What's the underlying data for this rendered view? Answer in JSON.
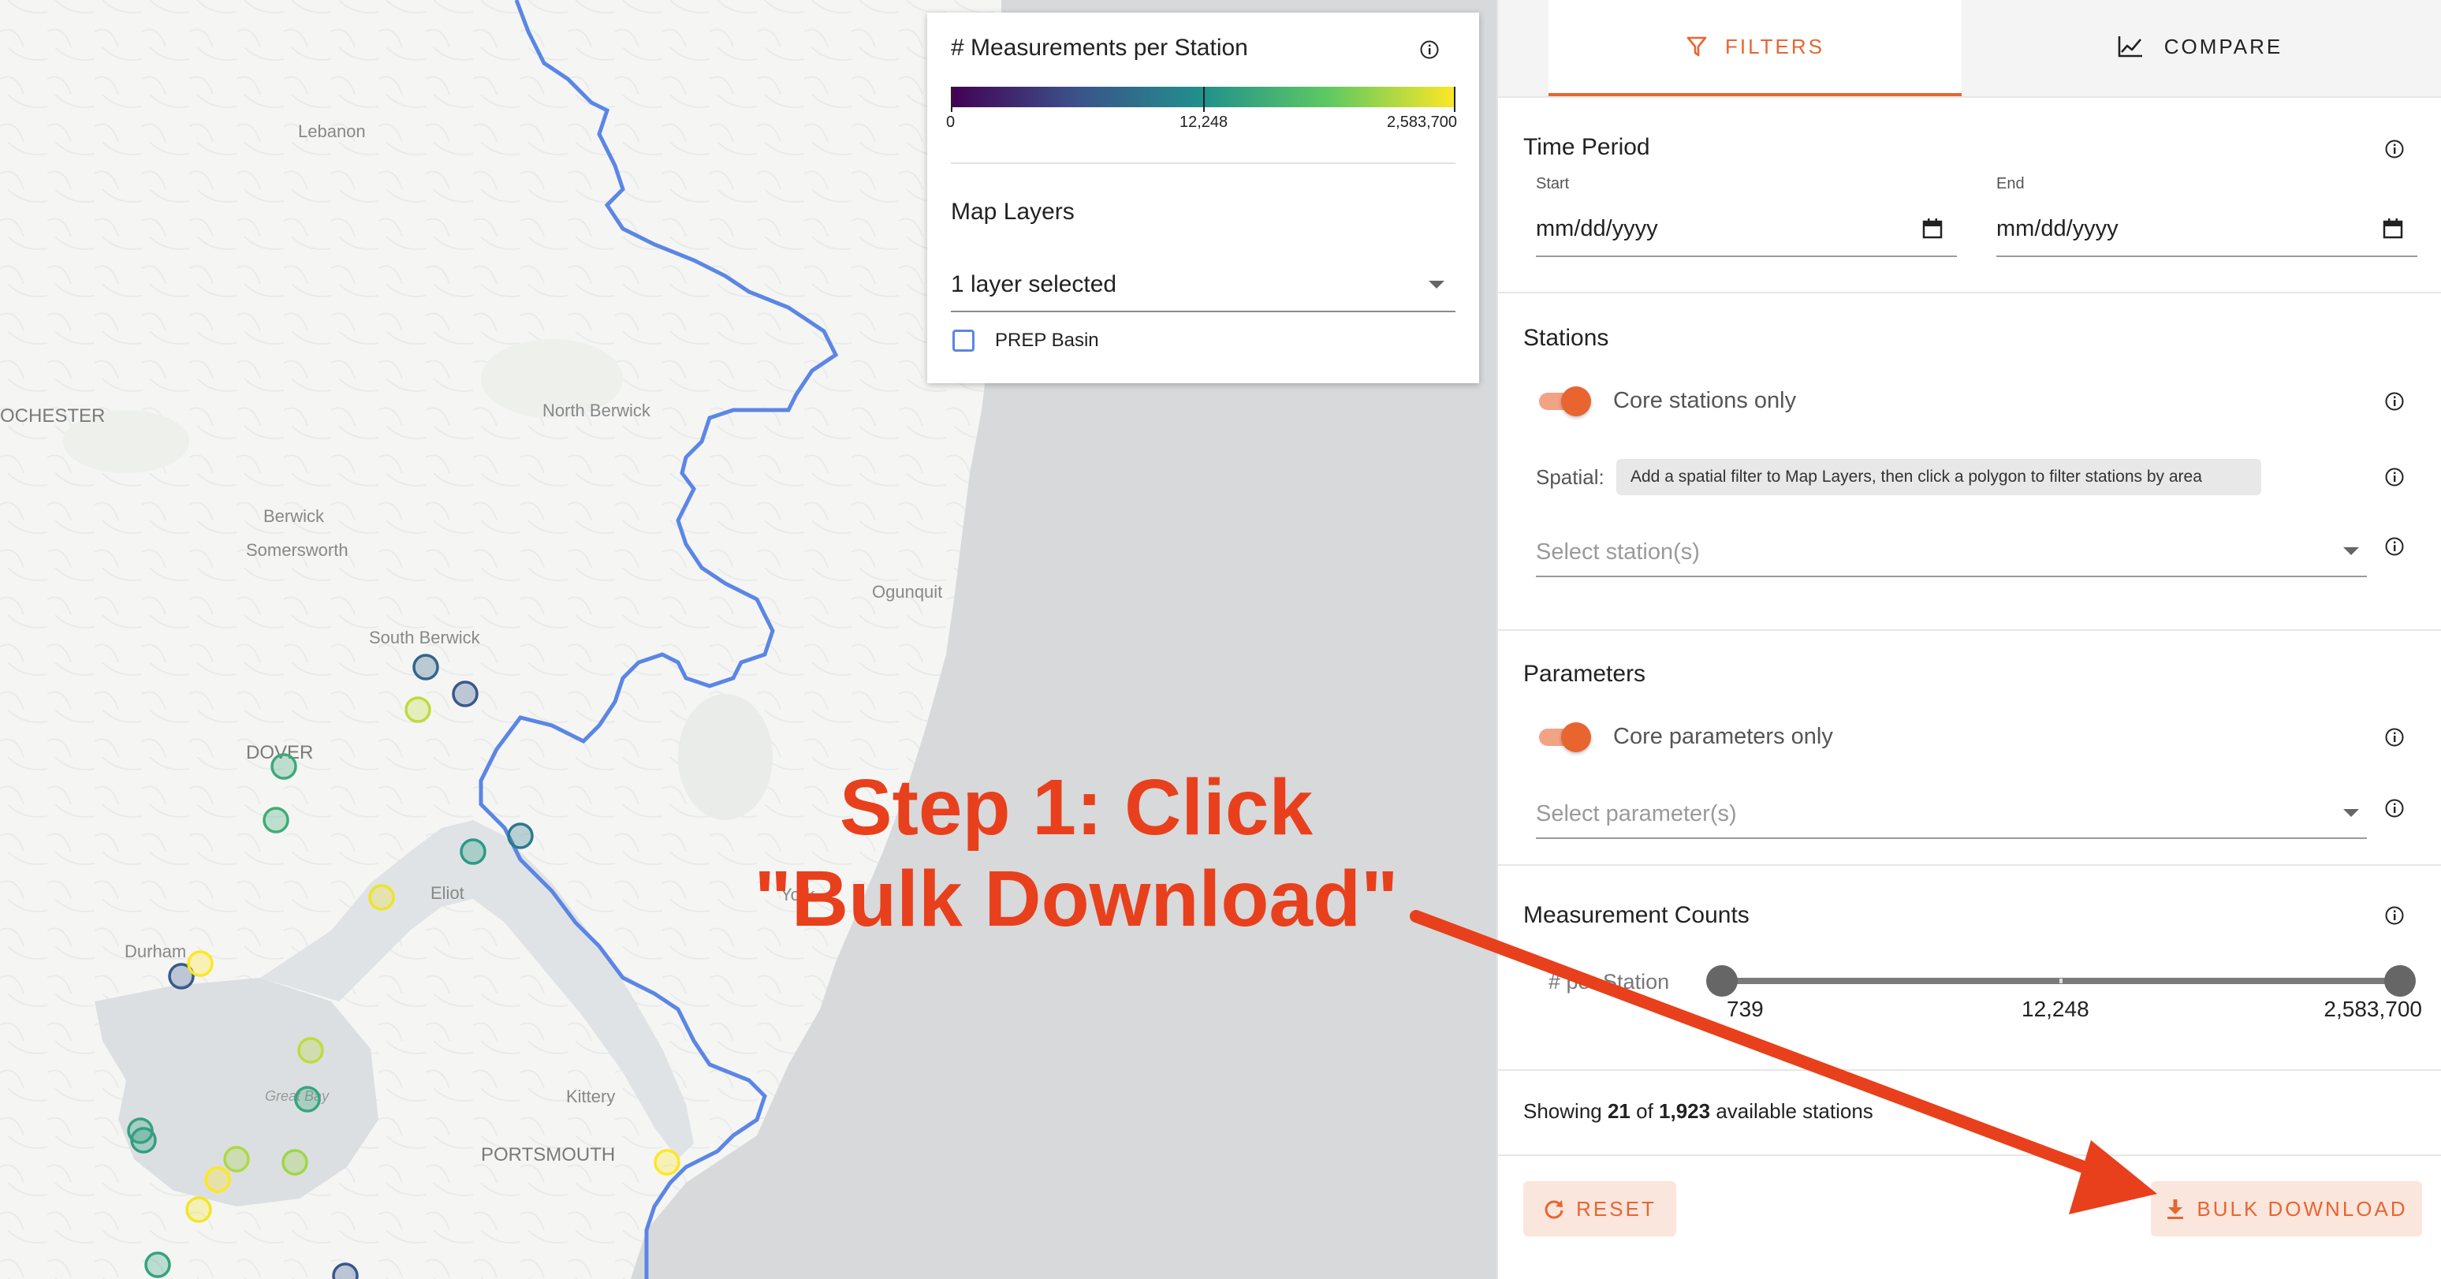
{
  "map": {
    "places": {
      "lebanon": "Lebanon",
      "rochester": "OCHESTER",
      "north_berwick": "North Berwick",
      "berwick": "Berwick",
      "somersworth": "Somersworth",
      "ogunquit": "Ogunquit",
      "south_berwick": "South Berwick",
      "dover": "DOVER",
      "eliot": "Eliot",
      "durham": "Durham",
      "york": "York",
      "great_bay": "Great Bay",
      "kittery": "Kittery",
      "portsmouth": "PORTSMOUTH"
    },
    "boundary_color": "#5b86e5",
    "station_counts": [
      120,
      60,
      600000,
      8000,
      10000,
      1800000,
      60,
      2500000,
      600000,
      6000,
      5000,
      4000,
      400000,
      2500000,
      300000,
      2000000,
      5000,
      50,
      2500000,
      3000,
      400
    ]
  },
  "legend": {
    "title": "# Measurements per Station",
    "min_label": "0",
    "mid_label": "12,248",
    "max_label": "2,583,700",
    "colors": [
      "#440154",
      "#3b528b",
      "#21918c",
      "#5ec962",
      "#fde725"
    ],
    "layers_title": "Map Layers",
    "layers_value": "1 layer selected",
    "layer_option": "PREP Basin",
    "layer_checked": false
  },
  "tabs": {
    "filters": "FILTERS",
    "compare": "COMPARE",
    "active": "filters"
  },
  "accent_color": "#e8652f",
  "time_period": {
    "title": "Time Period",
    "start_label": "Start",
    "start_value": "mm/dd/yyyy",
    "end_label": "End",
    "end_value": "mm/dd/yyyy"
  },
  "stations": {
    "title": "Stations",
    "core_only_label": "Core stations only",
    "core_only_on": true,
    "spatial_label": "Spatial:",
    "spatial_hint": "Add a spatial filter to Map Layers, then click a polygon to filter stations by area",
    "select_placeholder": "Select station(s)"
  },
  "parameters": {
    "title": "Parameters",
    "core_only_label": "Core parameters only",
    "core_only_on": true,
    "select_placeholder": "Select parameter(s)"
  },
  "measurement_counts": {
    "title": "Measurement Counts",
    "per_station_label": "# per Station",
    "min": "739",
    "mid": "12,248",
    "max": "2,583,700"
  },
  "summary": {
    "prefix": "Showing ",
    "shown": "21",
    "middle": " of ",
    "total": "1,923",
    "suffix": " available stations"
  },
  "actions": {
    "reset": "RESET",
    "bulk_download": "BULK DOWNLOAD"
  },
  "annotation": {
    "line1": "Step 1: Click",
    "line2": "\"Bulk Download\"",
    "color": "#e8401c"
  }
}
